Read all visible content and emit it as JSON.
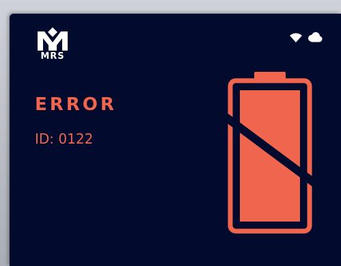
{
  "device": {
    "brand_text": "MRS",
    "status_icons": [
      "wifi-icon",
      "cloud-icon"
    ],
    "accent_color": "#f0654e",
    "background_color": "#020b2d"
  },
  "error": {
    "title": "ERROR",
    "id_label": "ID:",
    "id_value": "0122",
    "icon": "battery-error-icon"
  }
}
